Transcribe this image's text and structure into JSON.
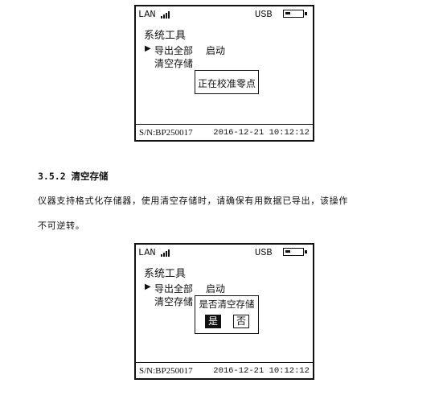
{
  "screen_top": {
    "status": {
      "lan": "LAN",
      "usb": "USB"
    },
    "menu_title": "系统工具",
    "items": [
      {
        "label": "导出全部",
        "value": "启动"
      },
      {
        "label": "清空存储"
      }
    ],
    "popup": "正在校准零点",
    "serial": "S/N:BP250017",
    "datetime": "2016-12-21 10:12:12"
  },
  "section": {
    "heading": "3.5.2 清空存储",
    "paragraph_line1": "仪器支持格式化存储器，使用清空存储时，请确保有用数据已导出，该操作",
    "paragraph_line2": "不可逆转。"
  },
  "screen_bottom": {
    "status": {
      "lan": "LAN",
      "usb": "USB"
    },
    "menu_title": "系统工具",
    "items": [
      {
        "label": "导出全部",
        "value": "启动"
      },
      {
        "label": "清空存储"
      }
    ],
    "popup": {
      "question": "是否清空存储",
      "yes": "是",
      "no": "否"
    },
    "serial": "S/N:BP250017",
    "datetime": "2016-12-21 10:12:12"
  },
  "icons": {
    "signal": "signal-bars-icon",
    "battery": "battery-icon",
    "selector": "triangle-right-icon"
  }
}
